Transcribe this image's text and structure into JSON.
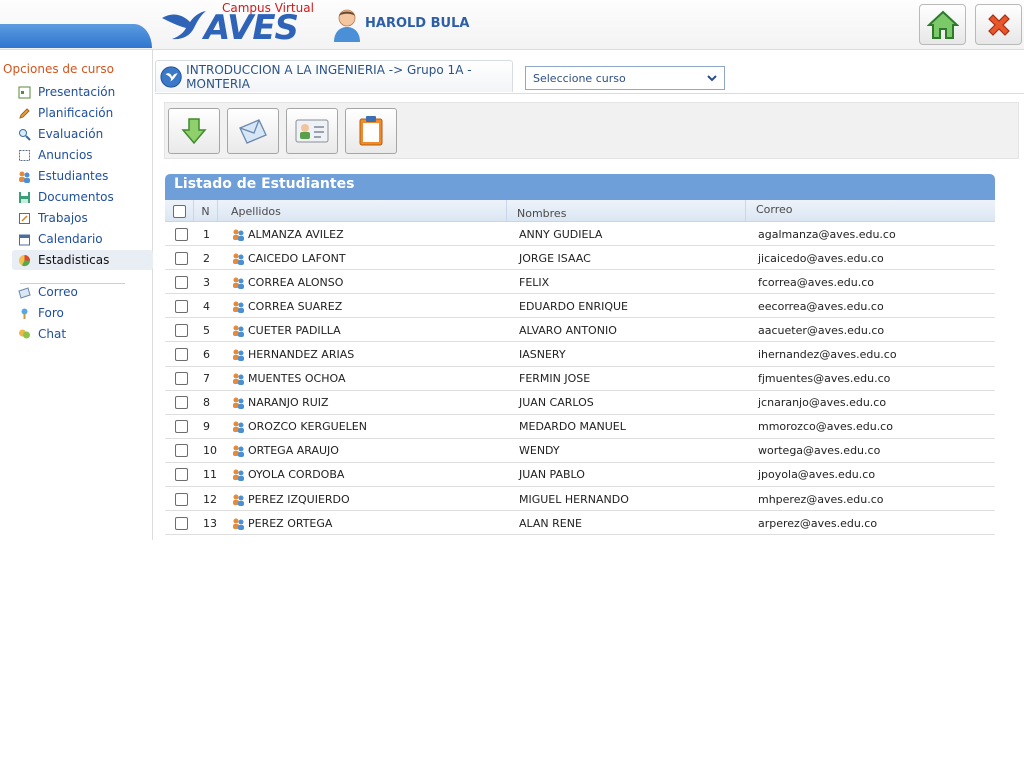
{
  "header": {
    "logo_subtitle": "Campus Virtual",
    "logo_word": "AVES",
    "user_name": "HAROLD BULA"
  },
  "sidebar": {
    "title": "Opciones de curso",
    "items": [
      {
        "label": "Presentación",
        "icon": "presentation-icon"
      },
      {
        "label": "Planificación",
        "icon": "pencil-icon"
      },
      {
        "label": "Evaluación",
        "icon": "magnifier-icon"
      },
      {
        "label": "Anuncios",
        "icon": "announcement-icon"
      },
      {
        "label": "Estudiantes",
        "icon": "students-icon"
      },
      {
        "label": "Documentos",
        "icon": "save-disk-icon"
      },
      {
        "label": "Trabajos",
        "icon": "assignment-icon"
      },
      {
        "label": "Calendario",
        "icon": "calendar-icon"
      },
      {
        "label": "Estadisticas",
        "icon": "statistics-icon"
      }
    ],
    "comm_items": [
      {
        "label": "Correo",
        "icon": "mail-icon"
      },
      {
        "label": "Foro",
        "icon": "forum-icon"
      },
      {
        "label": "Chat",
        "icon": "chat-icon"
      }
    ]
  },
  "course": {
    "title": "INTRODUCCION A LA INGENIERIA -> Grupo 1A - MONTERIA",
    "select_value": "Seleccione curso"
  },
  "toolbar": {
    "buttons": [
      "download-icon",
      "send-mail-icon",
      "student-card-icon",
      "clipboard-icon"
    ]
  },
  "list": {
    "title": "Listado de Estudiantes",
    "columns": {
      "n": "N",
      "apellidos": "Apellidos",
      "nombres": "Nombres",
      "correo": "Correo"
    },
    "rows": [
      {
        "n": "1",
        "apellidos": "ALMANZA  AVILEZ",
        "nombres": "ANNY  GUDIELA",
        "correo": "agalmanza@aves.edu.co"
      },
      {
        "n": "2",
        "apellidos": "CAICEDO  LAFONT",
        "nombres": "JORGE  ISAAC",
        "correo": "jicaicedo@aves.edu.co"
      },
      {
        "n": "3",
        "apellidos": "CORREA  ALONSO",
        "nombres": "FELIX",
        "correo": "fcorrea@aves.edu.co"
      },
      {
        "n": "4",
        "apellidos": "CORREA  SUAREZ",
        "nombres": "EDUARDO  ENRIQUE",
        "correo": "eecorrea@aves.edu.co"
      },
      {
        "n": "5",
        "apellidos": "CUETER  PADILLA",
        "nombres": "ALVARO  ANTONIO",
        "correo": "aacueter@aves.edu.co"
      },
      {
        "n": "6",
        "apellidos": "HERNANDEZ  ARIAS",
        "nombres": "IASNERY",
        "correo": "ihernandez@aves.edu.co"
      },
      {
        "n": "7",
        "apellidos": "MUENTES  OCHOA",
        "nombres": "FERMIN  JOSE",
        "correo": "fjmuentes@aves.edu.co"
      },
      {
        "n": "8",
        "apellidos": "NARANJO  RUIZ",
        "nombres": "JUAN  CARLOS",
        "correo": "jcnaranjo@aves.edu.co"
      },
      {
        "n": "9",
        "apellidos": "OROZCO  KERGUELEN",
        "nombres": "MEDARDO  MANUEL",
        "correo": "mmorozco@aves.edu.co"
      },
      {
        "n": "10",
        "apellidos": "ORTEGA  ARAUJO",
        "nombres": "WENDY",
        "correo": "wortega@aves.edu.co"
      },
      {
        "n": "11",
        "apellidos": "OYOLA  CORDOBA",
        "nombres": "JUAN  PABLO",
        "correo": "jpoyola@aves.edu.co"
      },
      {
        "n": "12",
        "apellidos": "PEREZ  IZQUIERDO",
        "nombres": "MIGUEL  HERNANDO",
        "correo": "mhperez@aves.edu.co"
      },
      {
        "n": "13",
        "apellidos": "PEREZ  ORTEGA",
        "nombres": "ALAN  RENE",
        "correo": "arperez@aves.edu.co"
      }
    ]
  }
}
